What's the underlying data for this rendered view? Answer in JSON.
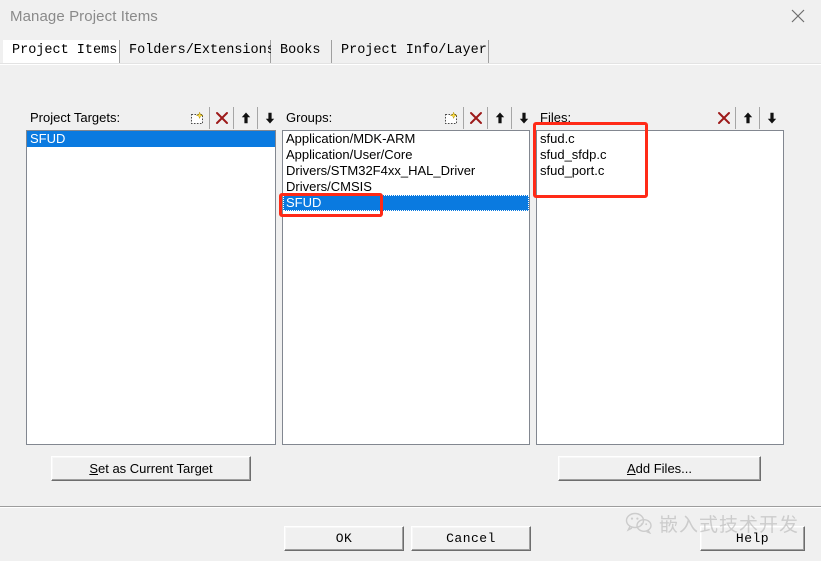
{
  "window": {
    "title": "Manage Project Items",
    "close_icon": "close-icon"
  },
  "tabs": [
    {
      "label": "Project Items",
      "active": true
    },
    {
      "label": "Folders/Extensions",
      "active": false
    },
    {
      "label": "Books",
      "active": false
    },
    {
      "label": "Project Info/Layer",
      "active": false
    }
  ],
  "panels": {
    "targets": {
      "label": "Project Targets:",
      "tools": [
        "new-item-icon",
        "delete-icon",
        "move-up-icon",
        "move-down-icon"
      ],
      "items": [
        {
          "label": "SFUD",
          "selected": true
        }
      ]
    },
    "groups": {
      "label": "Groups:",
      "tools": [
        "new-item-icon",
        "delete-icon",
        "move-up-icon",
        "move-down-icon"
      ],
      "items": [
        {
          "label": "Application/MDK-ARM",
          "selected": false
        },
        {
          "label": "Application/User/Core",
          "selected": false
        },
        {
          "label": "Drivers/STM32F4xx_HAL_Driver",
          "selected": false
        },
        {
          "label": "Drivers/CMSIS",
          "selected": false
        },
        {
          "label": "SFUD",
          "selected": true
        }
      ]
    },
    "files": {
      "label": "Files:",
      "tools": [
        "delete-icon",
        "move-up-icon",
        "move-down-icon"
      ],
      "items": [
        {
          "label": "sfud.c",
          "selected": false
        },
        {
          "label": "sfud_sfdp.c",
          "selected": false
        },
        {
          "label": "sfud_port.c",
          "selected": false
        }
      ]
    }
  },
  "actions": {
    "set_current_target": {
      "prefix": "S",
      "rest": "et as Current Target"
    },
    "add_files": {
      "prefix": "A",
      "rest": "dd Files..."
    }
  },
  "footer": {
    "ok": "OK",
    "cancel": "Cancel",
    "help": "Help"
  },
  "watermark": {
    "logo": "wechat-logo-icon",
    "text": "嵌入式技术开发"
  },
  "colors": {
    "selection_blue": "#0a7ae0",
    "annotation_red": "#ff2a17",
    "delete_icon_red": "#9d1a1a",
    "dialog_bg": "#f0f0f0"
  }
}
